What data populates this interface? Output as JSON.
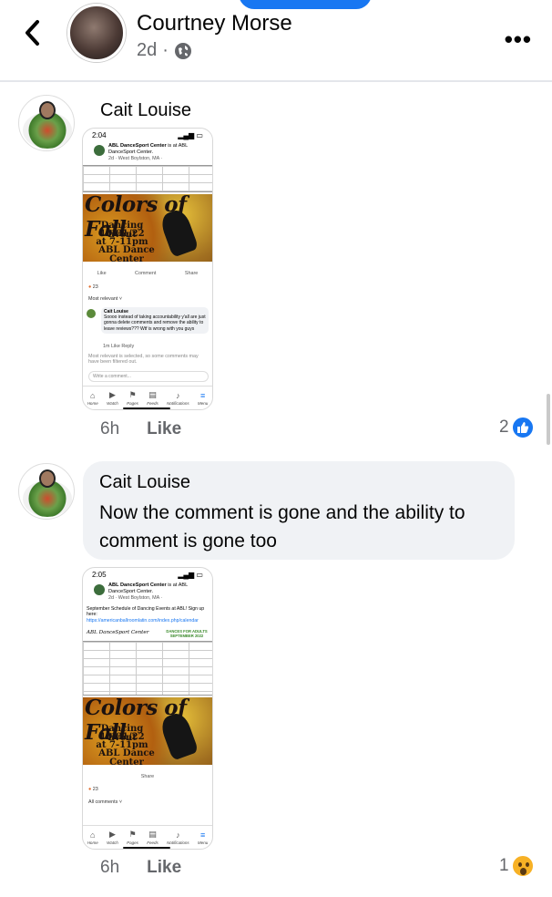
{
  "header": {
    "author": "Courtney Morse",
    "time": "2d",
    "separator": "·"
  },
  "comments": [
    {
      "author": "Cait Louise",
      "text": "",
      "time": "6h",
      "like_label": "Like",
      "reaction_count": "2",
      "reaction": "like-icon",
      "screenshot": {
        "time": "2:04",
        "page": "ABL DanceSport Center",
        "page_suffix": "is at ABL DanceSport Center.",
        "location": "2d · West Boylston, MA ·",
        "poster_title": "Colors of Fall",
        "poster_lines": [
          "Dancing Event",
          "10/01/22",
          "at 7-11pm",
          "ABL Dance Center"
        ],
        "actions": [
          "Like",
          "Comment",
          "Share"
        ],
        "reactions": "23",
        "sort": "Most relevant ˅",
        "inner_comment_author": "Cait Louise",
        "inner_comment": "Soooo instead of taking accountability y'all are just gonna delete comments and remove the ability to leave reviews??? Wtf is wrong with you guys",
        "inner_comment_meta": "1m   Like   Reply",
        "filter_note": "Most relevant is selected, so some comments may have been filtered out.",
        "write_placeholder": "Write a comment...",
        "tabs": [
          "Home",
          "Watch",
          "Pages",
          "Feeds",
          "Notifications",
          "Menu"
        ]
      }
    },
    {
      "author": "Cait Louise",
      "text": "Now the comment is gone and the ability to comment is gone too",
      "time": "6h",
      "like_label": "Like",
      "reaction_count": "1",
      "reaction": "wow-icon",
      "screenshot": {
        "time": "2:05",
        "page": "ABL DanceSport Center",
        "page_suffix": "is at ABL DanceSport Center.",
        "location": "2d · West Boylston, MA ·",
        "post_text": "September Schedule of Dancing Events at ABL! Sign up here:",
        "post_link": "https://americanballroomlatin.com/index.php/calendar",
        "schedule_logo": "ABL DanceSport Center",
        "schedule_heading": "DANCES FOR ADULTS",
        "schedule_month": "SEPTEMBER 2022",
        "poster_title": "Colors of Fall",
        "poster_lines": [
          "Dancing Event",
          "10/01/22",
          "at 7-11pm",
          "ABL Dance Center"
        ],
        "actions": [
          "Share"
        ],
        "reactions": "23",
        "sort": "All comments ˅",
        "tabs": [
          "Home",
          "Watch",
          "Pages",
          "Feeds",
          "Notifications",
          "Menu"
        ]
      }
    }
  ],
  "colors": {
    "accent": "#1877f2",
    "meta": "#65676b",
    "bubble": "#f0f2f5"
  }
}
